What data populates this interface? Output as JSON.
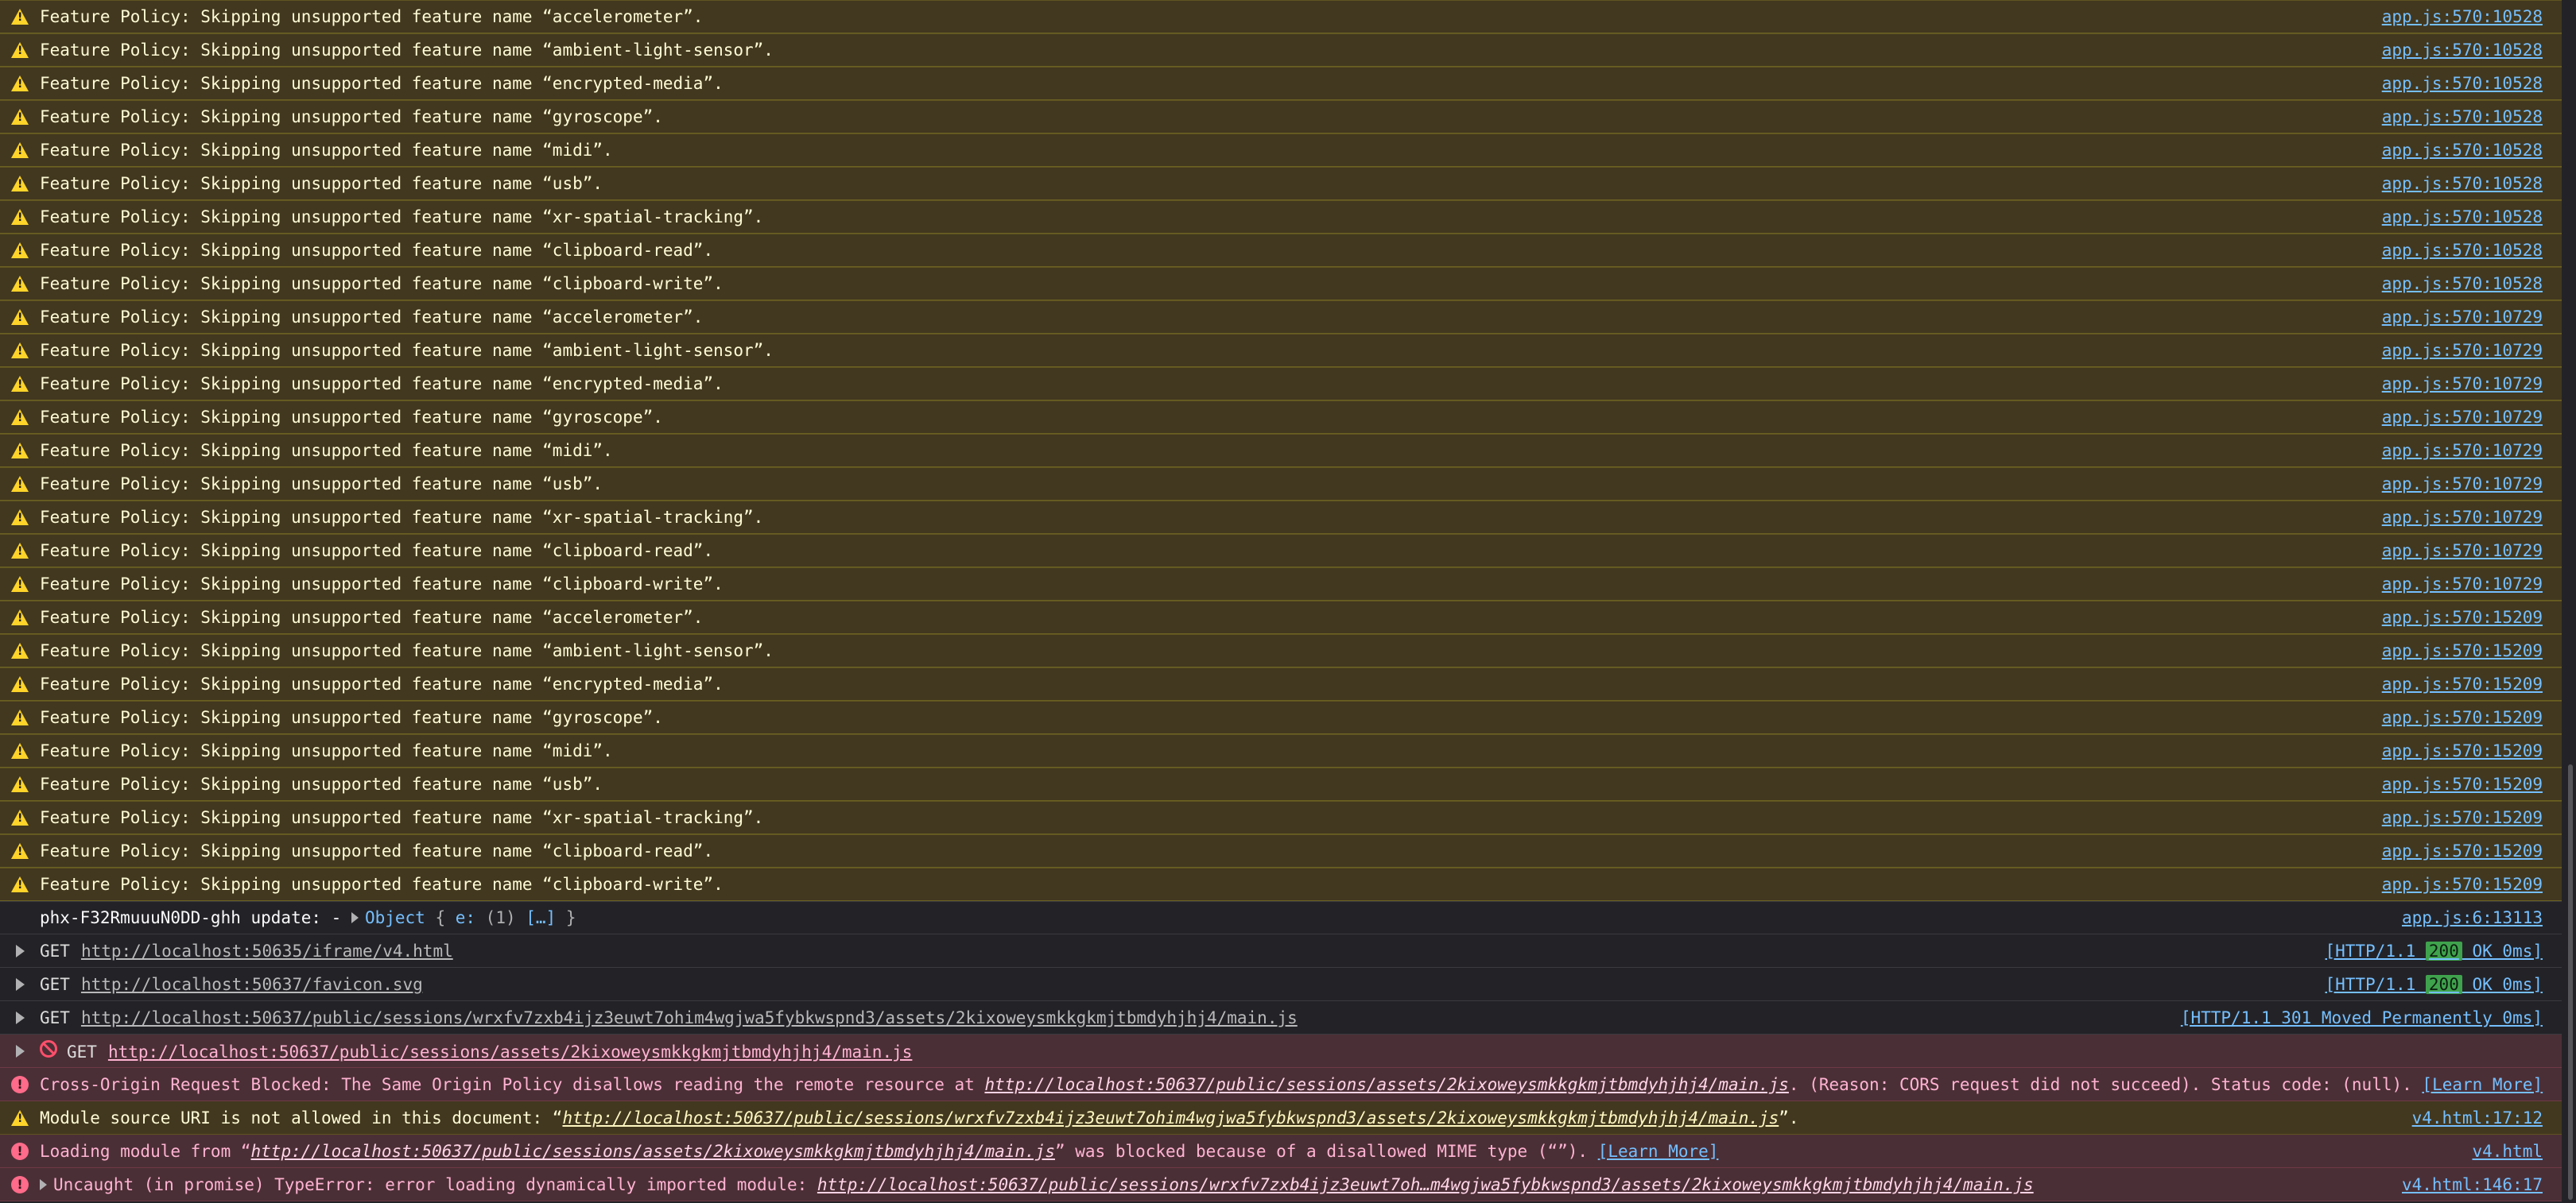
{
  "warnings": [
    {
      "text": "Feature Policy: Skipping unsupported feature name “accelerometer”.",
      "loc": "app.js:570:10528"
    },
    {
      "text": "Feature Policy: Skipping unsupported feature name “ambient-light-sensor”.",
      "loc": "app.js:570:10528"
    },
    {
      "text": "Feature Policy: Skipping unsupported feature name “encrypted-media”.",
      "loc": "app.js:570:10528"
    },
    {
      "text": "Feature Policy: Skipping unsupported feature name “gyroscope”.",
      "loc": "app.js:570:10528"
    },
    {
      "text": "Feature Policy: Skipping unsupported feature name “midi”.",
      "loc": "app.js:570:10528"
    },
    {
      "text": "Feature Policy: Skipping unsupported feature name “usb”.",
      "loc": "app.js:570:10528"
    },
    {
      "text": "Feature Policy: Skipping unsupported feature name “xr-spatial-tracking”.",
      "loc": "app.js:570:10528"
    },
    {
      "text": "Feature Policy: Skipping unsupported feature name “clipboard-read”.",
      "loc": "app.js:570:10528"
    },
    {
      "text": "Feature Policy: Skipping unsupported feature name “clipboard-write”.",
      "loc": "app.js:570:10528"
    },
    {
      "text": "Feature Policy: Skipping unsupported feature name “accelerometer”.",
      "loc": "app.js:570:10729"
    },
    {
      "text": "Feature Policy: Skipping unsupported feature name “ambient-light-sensor”.",
      "loc": "app.js:570:10729"
    },
    {
      "text": "Feature Policy: Skipping unsupported feature name “encrypted-media”.",
      "loc": "app.js:570:10729"
    },
    {
      "text": "Feature Policy: Skipping unsupported feature name “gyroscope”.",
      "loc": "app.js:570:10729"
    },
    {
      "text": "Feature Policy: Skipping unsupported feature name “midi”.",
      "loc": "app.js:570:10729"
    },
    {
      "text": "Feature Policy: Skipping unsupported feature name “usb”.",
      "loc": "app.js:570:10729"
    },
    {
      "text": "Feature Policy: Skipping unsupported feature name “xr-spatial-tracking”.",
      "loc": "app.js:570:10729"
    },
    {
      "text": "Feature Policy: Skipping unsupported feature name “clipboard-read”.",
      "loc": "app.js:570:10729"
    },
    {
      "text": "Feature Policy: Skipping unsupported feature name “clipboard-write”.",
      "loc": "app.js:570:10729"
    },
    {
      "text": "Feature Policy: Skipping unsupported feature name “accelerometer”.",
      "loc": "app.js:570:15209"
    },
    {
      "text": "Feature Policy: Skipping unsupported feature name “ambient-light-sensor”.",
      "loc": "app.js:570:15209"
    },
    {
      "text": "Feature Policy: Skipping unsupported feature name “encrypted-media”.",
      "loc": "app.js:570:15209"
    },
    {
      "text": "Feature Policy: Skipping unsupported feature name “gyroscope”.",
      "loc": "app.js:570:15209"
    },
    {
      "text": "Feature Policy: Skipping unsupported feature name “midi”.",
      "loc": "app.js:570:15209"
    },
    {
      "text": "Feature Policy: Skipping unsupported feature name “usb”.",
      "loc": "app.js:570:15209"
    },
    {
      "text": "Feature Policy: Skipping unsupported feature name “xr-spatial-tracking”.",
      "loc": "app.js:570:15209"
    },
    {
      "text": "Feature Policy: Skipping unsupported feature name “clipboard-read”.",
      "loc": "app.js:570:15209"
    },
    {
      "text": "Feature Policy: Skipping unsupported feature name “clipboard-write”.",
      "loc": "app.js:570:15209"
    }
  ],
  "log_row": {
    "prefix": "phx-F32RmuuuN0DD-ghh update:  - ",
    "object_label": "Object",
    "object_open": " { ",
    "object_key": "e:",
    "object_count": " (1) ",
    "object_value": "[…]",
    "object_close": " }",
    "loc": "app.js:6:13113"
  },
  "network": [
    {
      "method": "GET",
      "url": "http://localhost:50635/iframe/v4.html",
      "status_pre": "[HTTP/1.1 ",
      "status_code": "200",
      "status_post": " OK 0ms]"
    },
    {
      "method": "GET",
      "url": "http://localhost:50637/favicon.svg",
      "status_pre": "[HTTP/1.1 ",
      "status_code": "200",
      "status_post": " OK 0ms]"
    },
    {
      "method": "GET",
      "url": "http://localhost:50637/public/sessions/wrxfv7zxb4ijz3euwt7ohim4wgjwa5fybkwspnd3/assets/2kixoweysmkkgkmjtbmdyhjhj4/main.js",
      "status_full": "[HTTP/1.1 301 Moved Permanently 0ms]"
    }
  ],
  "blocked_request": {
    "method": "GET",
    "url": "http://localhost:50637/public/sessions/assets/2kixoweysmkkgkmjtbmdyhjhj4/main.js"
  },
  "cors_error": {
    "pre": "Cross-Origin Request Blocked: The Same Origin Policy disallows reading the remote resource at ",
    "url": "http://localhost:50637/public/sessions/assets/2kixoweysmkkgkmjtbmdyhjhj4/main.js",
    "post": ". (Reason: CORS request did not succeed). Status code: (null). ",
    "learn": "[Learn More]"
  },
  "module_warning": {
    "pre": "Module source URI is not allowed in this document: “",
    "url": "http://localhost:50637/public/sessions/wrxfv7zxb4ijz3euwt7ohim4wgjwa5fybkwspnd3/assets/2kixoweysmkkgkmjtbmdyhjhj4/main.js",
    "post": "”.",
    "loc": "v4.html:17:12"
  },
  "mime_error": {
    "pre": "Loading module from “",
    "url": "http://localhost:50637/public/sessions/assets/2kixoweysmkkgkmjtbmdyhjhj4/main.js",
    "post": "” was blocked because of a disallowed MIME type (“”). ",
    "learn": "[Learn More]",
    "loc": "v4.html"
  },
  "typeerror": {
    "pre": "Uncaught (in promise) TypeError: error loading dynamically imported module: ",
    "url": "http://localhost:50637/public/sessions/wrxfv7zxb4ijz3euwt7oh…m4wgjwa5fybkwspnd3/assets/2kixoweysmkkgkmjtbmdyhjhj4/main.js",
    "loc": "v4.html:146:17"
  },
  "colors": {
    "warning_bg": "#42381f",
    "error_bg": "#4b2f36",
    "link": "#75bfff",
    "warning_icon": "#ffd42a",
    "error_icon": "#ff6b8a",
    "status_ok": "#3fa34d"
  }
}
